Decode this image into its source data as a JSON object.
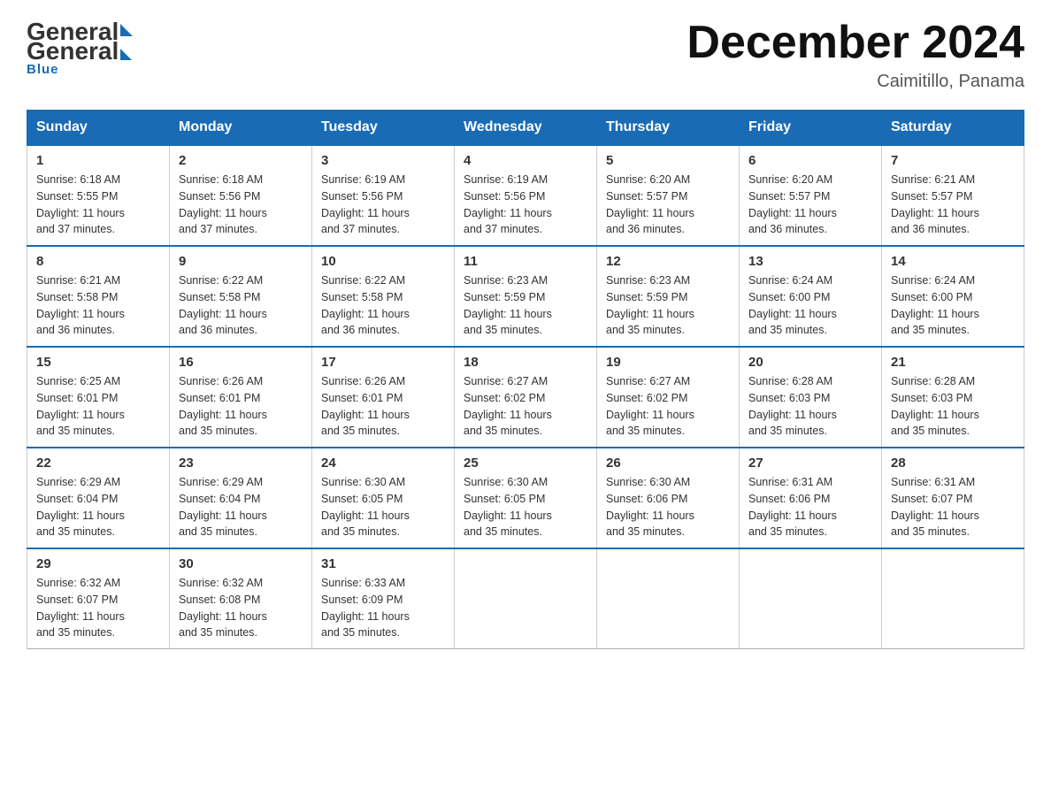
{
  "header": {
    "logo_general": "General",
    "logo_blue": "Blue",
    "month_title": "December 2024",
    "location": "Caimitillo, Panama"
  },
  "weekdays": [
    "Sunday",
    "Monday",
    "Tuesday",
    "Wednesday",
    "Thursday",
    "Friday",
    "Saturday"
  ],
  "weeks": [
    [
      {
        "day": "1",
        "sunrise": "6:18 AM",
        "sunset": "5:55 PM",
        "daylight": "11 hours and 37 minutes."
      },
      {
        "day": "2",
        "sunrise": "6:18 AM",
        "sunset": "5:56 PM",
        "daylight": "11 hours and 37 minutes."
      },
      {
        "day": "3",
        "sunrise": "6:19 AM",
        "sunset": "5:56 PM",
        "daylight": "11 hours and 37 minutes."
      },
      {
        "day": "4",
        "sunrise": "6:19 AM",
        "sunset": "5:56 PM",
        "daylight": "11 hours and 37 minutes."
      },
      {
        "day": "5",
        "sunrise": "6:20 AM",
        "sunset": "5:57 PM",
        "daylight": "11 hours and 36 minutes."
      },
      {
        "day": "6",
        "sunrise": "6:20 AM",
        "sunset": "5:57 PM",
        "daylight": "11 hours and 36 minutes."
      },
      {
        "day": "7",
        "sunrise": "6:21 AM",
        "sunset": "5:57 PM",
        "daylight": "11 hours and 36 minutes."
      }
    ],
    [
      {
        "day": "8",
        "sunrise": "6:21 AM",
        "sunset": "5:58 PM",
        "daylight": "11 hours and 36 minutes."
      },
      {
        "day": "9",
        "sunrise": "6:22 AM",
        "sunset": "5:58 PM",
        "daylight": "11 hours and 36 minutes."
      },
      {
        "day": "10",
        "sunrise": "6:22 AM",
        "sunset": "5:58 PM",
        "daylight": "11 hours and 36 minutes."
      },
      {
        "day": "11",
        "sunrise": "6:23 AM",
        "sunset": "5:59 PM",
        "daylight": "11 hours and 35 minutes."
      },
      {
        "day": "12",
        "sunrise": "6:23 AM",
        "sunset": "5:59 PM",
        "daylight": "11 hours and 35 minutes."
      },
      {
        "day": "13",
        "sunrise": "6:24 AM",
        "sunset": "6:00 PM",
        "daylight": "11 hours and 35 minutes."
      },
      {
        "day": "14",
        "sunrise": "6:24 AM",
        "sunset": "6:00 PM",
        "daylight": "11 hours and 35 minutes."
      }
    ],
    [
      {
        "day": "15",
        "sunrise": "6:25 AM",
        "sunset": "6:01 PM",
        "daylight": "11 hours and 35 minutes."
      },
      {
        "day": "16",
        "sunrise": "6:26 AM",
        "sunset": "6:01 PM",
        "daylight": "11 hours and 35 minutes."
      },
      {
        "day": "17",
        "sunrise": "6:26 AM",
        "sunset": "6:01 PM",
        "daylight": "11 hours and 35 minutes."
      },
      {
        "day": "18",
        "sunrise": "6:27 AM",
        "sunset": "6:02 PM",
        "daylight": "11 hours and 35 minutes."
      },
      {
        "day": "19",
        "sunrise": "6:27 AM",
        "sunset": "6:02 PM",
        "daylight": "11 hours and 35 minutes."
      },
      {
        "day": "20",
        "sunrise": "6:28 AM",
        "sunset": "6:03 PM",
        "daylight": "11 hours and 35 minutes."
      },
      {
        "day": "21",
        "sunrise": "6:28 AM",
        "sunset": "6:03 PM",
        "daylight": "11 hours and 35 minutes."
      }
    ],
    [
      {
        "day": "22",
        "sunrise": "6:29 AM",
        "sunset": "6:04 PM",
        "daylight": "11 hours and 35 minutes."
      },
      {
        "day": "23",
        "sunrise": "6:29 AM",
        "sunset": "6:04 PM",
        "daylight": "11 hours and 35 minutes."
      },
      {
        "day": "24",
        "sunrise": "6:30 AM",
        "sunset": "6:05 PM",
        "daylight": "11 hours and 35 minutes."
      },
      {
        "day": "25",
        "sunrise": "6:30 AM",
        "sunset": "6:05 PM",
        "daylight": "11 hours and 35 minutes."
      },
      {
        "day": "26",
        "sunrise": "6:30 AM",
        "sunset": "6:06 PM",
        "daylight": "11 hours and 35 minutes."
      },
      {
        "day": "27",
        "sunrise": "6:31 AM",
        "sunset": "6:06 PM",
        "daylight": "11 hours and 35 minutes."
      },
      {
        "day": "28",
        "sunrise": "6:31 AM",
        "sunset": "6:07 PM",
        "daylight": "11 hours and 35 minutes."
      }
    ],
    [
      {
        "day": "29",
        "sunrise": "6:32 AM",
        "sunset": "6:07 PM",
        "daylight": "11 hours and 35 minutes."
      },
      {
        "day": "30",
        "sunrise": "6:32 AM",
        "sunset": "6:08 PM",
        "daylight": "11 hours and 35 minutes."
      },
      {
        "day": "31",
        "sunrise": "6:33 AM",
        "sunset": "6:09 PM",
        "daylight": "11 hours and 35 minutes."
      },
      null,
      null,
      null,
      null
    ]
  ],
  "labels": {
    "sunrise": "Sunrise:",
    "sunset": "Sunset:",
    "daylight": "Daylight:"
  }
}
